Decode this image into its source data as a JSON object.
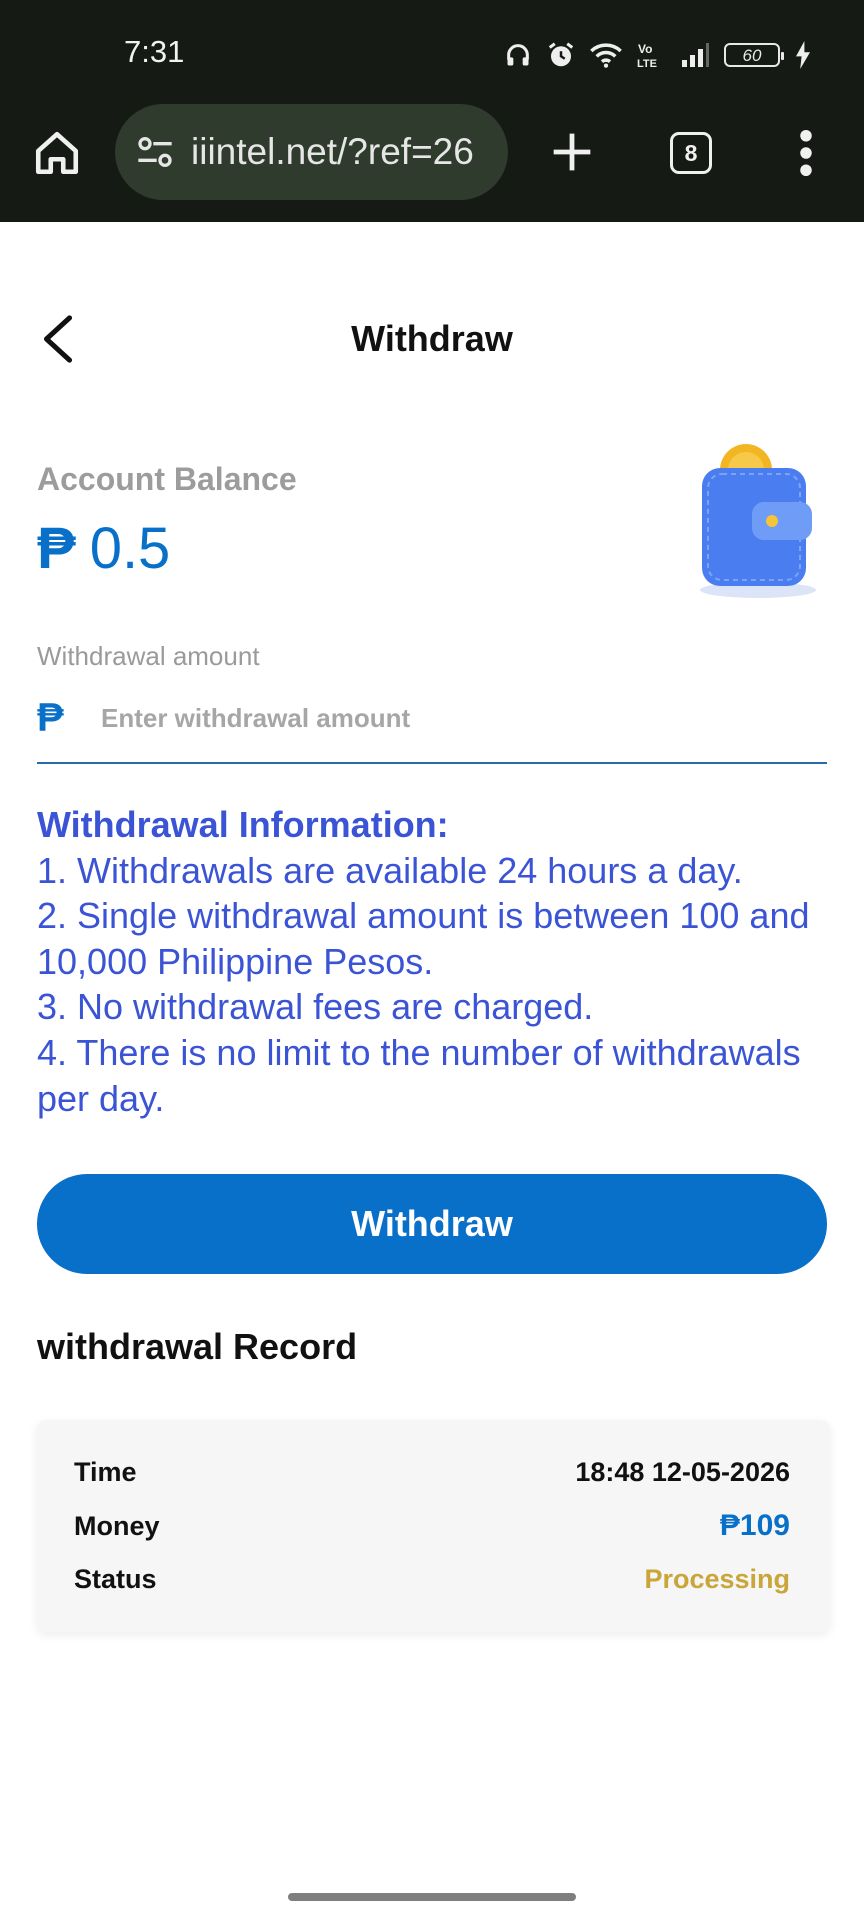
{
  "status_bar": {
    "time": "7:31",
    "battery": "60",
    "icons": [
      "headphones-icon",
      "alarm-icon",
      "wifi-icon",
      "volte-icon",
      "signal-icon",
      "battery-icon",
      "charging-icon"
    ]
  },
  "browser": {
    "url": "iiintel.net/?ref=26",
    "tab_count": "8"
  },
  "header": {
    "title": "Withdraw"
  },
  "balance": {
    "label": "Account Balance",
    "currency": "₱",
    "amount": "0.5"
  },
  "withdraw_form": {
    "label": "Withdrawal amount",
    "currency": "₱",
    "placeholder": "Enter withdrawal amount",
    "value": ""
  },
  "info": {
    "title": "Withdrawal Information:",
    "lines": [
      "1. Withdrawals are available 24 hours a day.",
      "2. Single withdrawal amount is between 100 and 10,000 Philippine Pesos.",
      "3. No withdrawal fees are charged.",
      "4. There is no limit to the number of withdrawals per day."
    ]
  },
  "withdraw_button": "Withdraw",
  "records": {
    "title": "withdrawal Record",
    "items": [
      {
        "time_label": "Time",
        "time": "18:48 12-05-2026",
        "money_label": "Money",
        "money": "₱109",
        "status_label": "Status",
        "status": "Processing"
      }
    ]
  },
  "colors": {
    "accent": "#0870c8",
    "info_text": "#3b54d6",
    "status_processing": "#c9a53a",
    "chrome_bg": "#151a14"
  }
}
